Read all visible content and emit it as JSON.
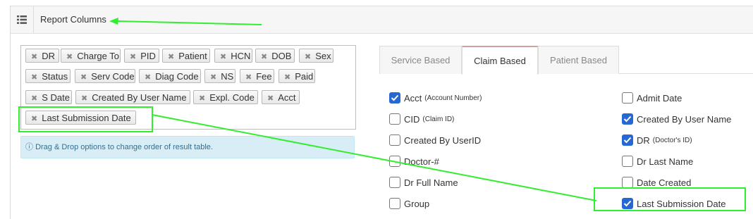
{
  "header": {
    "title": "Report Columns",
    "list_icon": "list-icon"
  },
  "selected_columns": {
    "tags": [
      "DR",
      "Charge To",
      "PID",
      "Patient",
      "HCN",
      "DOB",
      "Sex",
      "Status",
      "Serv Code",
      "Diag Code",
      "NS",
      "Fee",
      "Paid",
      "S Date",
      "Created By User Name",
      "Expl. Code",
      "Acct",
      "Last Submission Date"
    ],
    "remove_icon": "close-icon"
  },
  "info": {
    "icon": "info-icon",
    "text": "Drag & Drop options to change order of result table."
  },
  "tabs": [
    {
      "label": "Service Based",
      "active": false
    },
    {
      "label": "Claim Based",
      "active": true
    },
    {
      "label": "Patient Based",
      "active": false
    }
  ],
  "options": {
    "left": [
      {
        "label": "Acct",
        "sub": "(Account Number)",
        "checked": true
      },
      {
        "label": "CID",
        "sub": "(Claim ID)",
        "checked": false
      },
      {
        "label": "Created By UserID",
        "sub": "",
        "checked": false
      },
      {
        "label": "Doctor-#",
        "sub": "",
        "checked": false
      },
      {
        "label": "Dr Full Name",
        "sub": "",
        "checked": false
      },
      {
        "label": "Group",
        "sub": "",
        "checked": false
      }
    ],
    "right": [
      {
        "label": "Admit Date",
        "sub": "",
        "checked": false
      },
      {
        "label": "Created By User Name",
        "sub": "",
        "checked": true
      },
      {
        "label": "DR",
        "sub": "(Doctor's ID)",
        "checked": true
      },
      {
        "label": "Dr Last Name",
        "sub": "",
        "checked": false
      },
      {
        "label": "Date Created",
        "sub": "",
        "checked": false
      },
      {
        "label": "Last Submission Date",
        "sub": "",
        "checked": true
      }
    ]
  },
  "colors": {
    "checkbox_checked": "#2568d4",
    "annotation": "#33ee2e",
    "info_bg": "#d9edf7"
  }
}
